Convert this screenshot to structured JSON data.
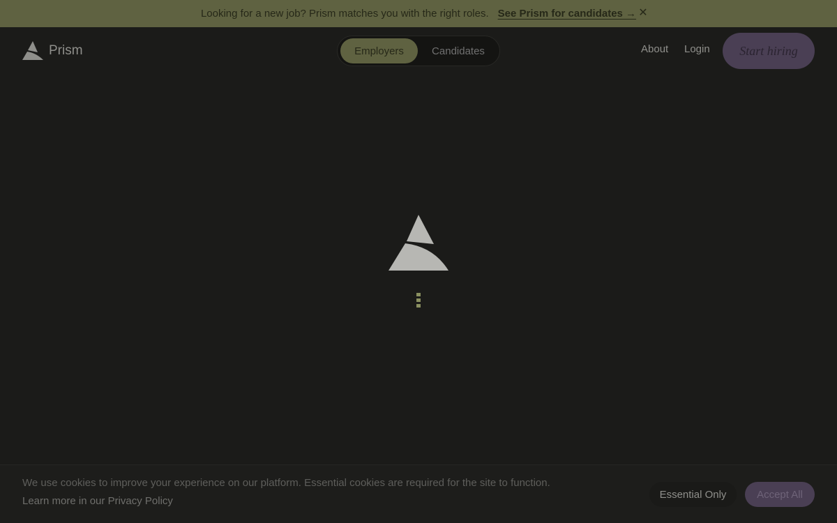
{
  "announcement": {
    "text": "Looking for a new job? Prism matches you with the right roles.",
    "link_label": "See Prism for candidates →",
    "close_glyph": "✕"
  },
  "nav": {
    "brand": "Prism",
    "toggle": [
      "Employers",
      "Candidates"
    ],
    "active_toggle": "Employers",
    "links": [
      "About",
      "Login"
    ],
    "cta": "Start hiring"
  },
  "cookie_banner": {
    "text": "We use cookies to improve your experience on our platform. Essential cookies are required for the site to function.",
    "policy_link": "Learn more in our Privacy Policy",
    "essential_label": "Essential Only",
    "accept_label": "Accept All"
  },
  "icons": {
    "brand": "prism-logo-icon",
    "loader": "prism-logo-icon",
    "close": "close-icon"
  },
  "colors": {
    "announcement_bg": "#5f6241",
    "cta_bg": "#4a3f54",
    "page_bg": "#1b1b19"
  }
}
